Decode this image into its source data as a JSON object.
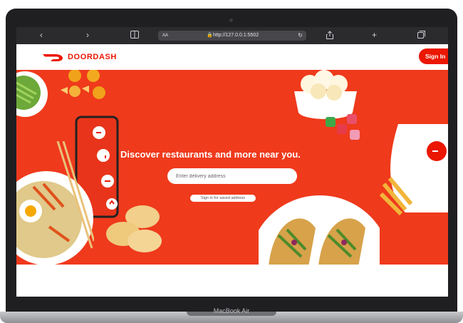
{
  "browser": {
    "text_size_label": "AA",
    "url": "http://127.0.0.1:5502",
    "back_icon": "chevron-left-icon",
    "forward_icon": "chevron-right-icon",
    "sidebar_icon": "sidebar-icon",
    "lock_icon": "lock-icon",
    "reload_icon": "reload-icon",
    "share_icon": "share-icon",
    "new_tab_icon": "plus-icon",
    "tabs_icon": "tabs-icon"
  },
  "navbar": {
    "logo_text": "DOORDASH",
    "sign_in_label": "Sign In"
  },
  "hero": {
    "headline": "Discover restaurants and more near you.",
    "address_placeholder": "Enter delivery address",
    "saved_address_label": "Sign in for saved address"
  },
  "device": {
    "brand_label": "MacBook Air"
  },
  "colors": {
    "brand_red": "#eb1700",
    "hero_red": "#ef3a1c"
  }
}
